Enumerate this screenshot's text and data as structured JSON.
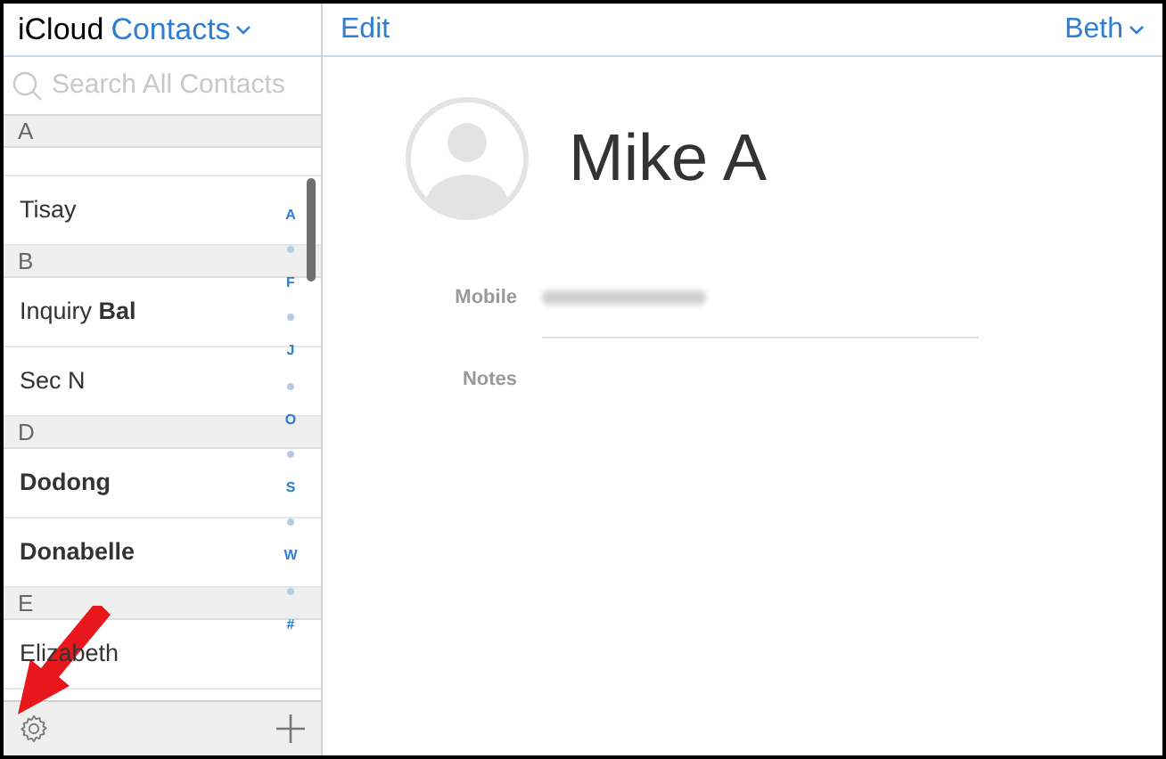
{
  "sidebar": {
    "title": {
      "app": "iCloud",
      "section": "Contacts"
    },
    "search": {
      "placeholder": "Search All Contacts"
    },
    "groups": [
      {
        "letter": "A",
        "contacts": [
          {
            "name": "Tisay",
            "bold": false
          }
        ]
      },
      {
        "letter": "B",
        "contacts": [
          {
            "name": "Inquiry **Bal**",
            "bold": false
          },
          {
            "name": "Sec N",
            "bold": false
          }
        ]
      },
      {
        "letter": "D",
        "contacts": [
          {
            "name": "Dodong",
            "bold": true
          },
          {
            "name": "Donabelle",
            "bold": true
          }
        ]
      },
      {
        "letter": "E",
        "contacts": [
          {
            "name": "Elizabeth",
            "bold": false
          }
        ]
      }
    ],
    "index": [
      {
        "kind": "letter",
        "text": "A"
      },
      {
        "kind": "dot"
      },
      {
        "kind": "letter",
        "text": "F"
      },
      {
        "kind": "dot"
      },
      {
        "kind": "letter",
        "text": "J"
      },
      {
        "kind": "dot"
      },
      {
        "kind": "letter",
        "text": "O"
      },
      {
        "kind": "dot"
      },
      {
        "kind": "letter",
        "text": "S"
      },
      {
        "kind": "dot"
      },
      {
        "kind": "letter",
        "text": "W"
      },
      {
        "kind": "dot"
      },
      {
        "kind": "letter",
        "text": "#"
      }
    ]
  },
  "detail": {
    "edit": "Edit",
    "account": "Beth",
    "name": "Mike A",
    "fields": [
      {
        "label": "Mobile",
        "kind": "blurred"
      },
      {
        "label": "Notes",
        "kind": "empty"
      }
    ]
  }
}
